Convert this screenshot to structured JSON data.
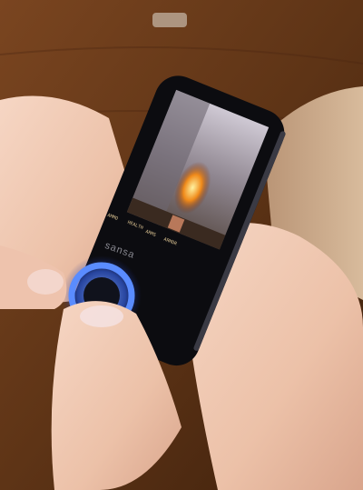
{
  "device": {
    "brand_text": "sansa"
  },
  "screen": {
    "hud_labels": [
      "AMMO",
      "HEALTH",
      "ARMS",
      "ARMOR"
    ]
  },
  "colors": {
    "wood_floor": "#6b3c1c",
    "couch": "#c9a98a",
    "device_body": "#0c0c10",
    "wheel_glow": "#3a6bff",
    "skin": "#f1c9b3"
  }
}
